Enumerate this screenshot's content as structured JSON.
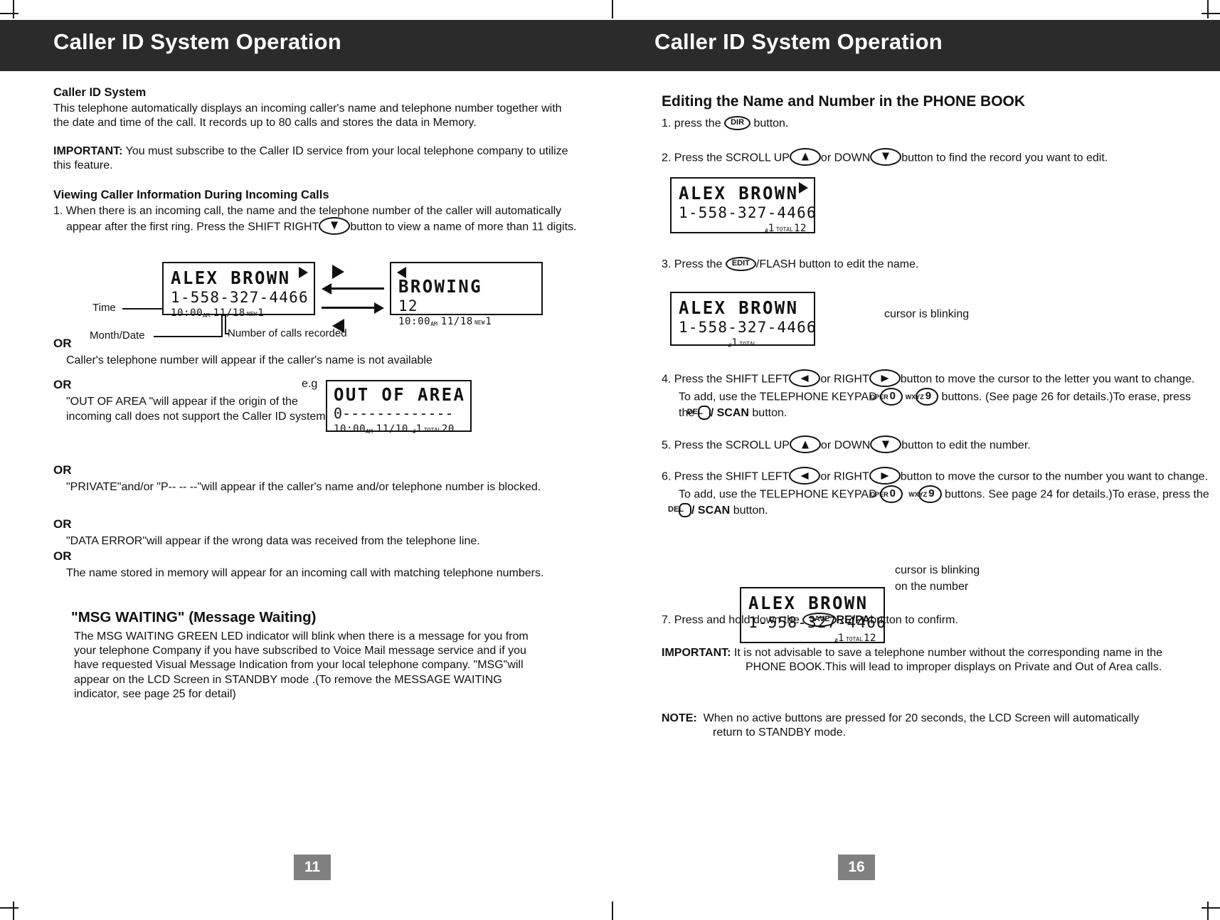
{
  "header": {
    "left_title": "Caller ID System Operation",
    "right_title": "Caller ID System Operation"
  },
  "page_numbers": {
    "left": "11",
    "right": "16"
  },
  "left_page": {
    "section1_heading": "Caller ID System",
    "section1_body": "This telephone automatically displays an incoming caller's name and telephone number together with the date and time of the call. It records up to 80 calls and stores the data in Memory.",
    "important_label": "IMPORTANT:",
    "important_body": " You must subscribe to the Caller ID service from your local telephone company to utilize this feature.",
    "section2_heading": "Viewing Caller Information During Incoming Calls",
    "step1_part1": "1. When there is an incoming call, the name and the telephone number of the caller will automatically appear after the first ring. Press the SHIFT RIGHT",
    "step1_part2": "button to view a name of more than 11 digits.",
    "callouts": {
      "time": "Time",
      "month_date": "Month/Date",
      "num_calls": "Number of calls recorded"
    },
    "lcd_primary": {
      "name": "ALEX BROWN",
      "number": "1-558-327-4466",
      "time": "10:00",
      "ampm": "AM",
      "date": "11/18",
      "new_label": "NEW",
      "count": "1",
      "arrow": "right-triangle"
    },
    "lcd_secondary": {
      "name": "BROWING",
      "number": "12",
      "time": "10:00",
      "ampm": "AM",
      "date": "11/18",
      "new_label": "NEW",
      "count": "1",
      "arrow": "left-triangle"
    },
    "or_label": "OR",
    "or1_body": "Caller's telephone number will appear if the caller's name is not available",
    "eg_label": "e.g",
    "or2_body": "\"OUT OF AREA \"will appear if the origin of the incoming call does not support the Caller ID system.",
    "lcd_out_of_area": {
      "line1": "OUT OF AREA",
      "line2": "0-------------",
      "time": "10:00",
      "ampm": "AM",
      "date": "11/10",
      "hash": "1",
      "total_label": "TOTAL",
      "total": "20"
    },
    "or3_body": "\"PRIVATE\"and/or \"P-- -- --\"will appear if the caller's name and/or telephone number is blocked.",
    "or4_body": "\"DATA ERROR\"will appear if the wrong data was received from the telephone line.",
    "or5_body": "The name stored in memory will appear for an incoming call with matching telephone numbers.",
    "msg_heading": "\"MSG WAITING\" (Message Waiting)",
    "msg_body": "The MSG WAITING GREEN LED indicator will blink when there is a message for you from your telephone Company if you have subscribed to Voice Mail message service and if you have requested Visual Message Indication from your local telephone company. \"MSG\"will appear on the LCD Screen in STANDBY mode .(To remove the MESSAGE WAITING indicator, see page 25 for detail)"
  },
  "right_page": {
    "heading": "Editing the Name and Number in the PHONE BOOK",
    "step1_pre": "1. press the",
    "step1_key": "DIR",
    "step1_post": "button.",
    "step2_pre": "2. Press the SCROLL UP",
    "step2_mid": "or DOWN",
    "step2_post": "button to find the record you want to edit.",
    "lcd_step2": {
      "name": "ALEX BROWN",
      "number": "1-558-327-4466",
      "hash": "1",
      "total_label": "TOTAL",
      "total": "12",
      "arrow": "right-triangle"
    },
    "step3_pre": "3. Press the",
    "step3_key": "EDIT",
    "step3_post": "/FLASH  button to edit the name.",
    "lcd_step3": {
      "name": "ALEX BROWN",
      "number": "1-558-327-4466",
      "hash": "1",
      "total_label": "TOTAL"
    },
    "note_cursor_name": "cursor is blinking",
    "step4_a": "4.  Press the SHIFT LEFT",
    "step4_b": "or RIGHT",
    "step4_c": "button to move the cursor to the letter you want to change. To add, use the TELEPHONE KEYPAD",
    "step4_d": "buttons.",
    "step4_e": "(See page 26 for details.)To erase,  press the",
    "step4_key_del": "DEL",
    "step4_f": "/ SCAN",
    "step4_g": "button.",
    "step5_a": "5.  Press the SCROLL  UP",
    "step5_b": "or DOWN",
    "step5_c": "button to edit the number.",
    "step6_a": "6.  Press  the SHIFT LEFT",
    "step6_b": "or RIGHT",
    "step6_c": "button to move the cursor to the number you want to change. To add, use the TELEPHONE KEYPAD",
    "step6_d": "buttons. See page 24 for details.)To erase, press the",
    "step6_e": "/ SCAN",
    "step6_f": "button.",
    "keypad_oper": "OPER",
    "keypad_oper_digit": "0",
    "keypad_wxyz": "WXYZ",
    "keypad_wxyz_digit": "9",
    "lcd_step6": {
      "name": "ALEX BROWN",
      "number": "1-558-327-4466",
      "hash": "1",
      "total_label": "TOTAL",
      "total": "12"
    },
    "note_cursor_number_l1": "cursor is blinking",
    "note_cursor_number_l2": "on the number",
    "step7_a": "7. Press and hold down the",
    "step7_key": "SAVE",
    "step7_b": "RE/PA",
    "step7_c": "button to confirm.",
    "important_label": "IMPORTANT:",
    "important_body": "It is not advisable to save a telephone number without the corresponding name in the PHONE BOOK.This will lead to improper displays on Private and Out of Area calls.",
    "note_label": "NOTE:",
    "note_body": "When no active buttons are pressed for 20 seconds, the LCD Screen will automatically return to STANDBY mode."
  },
  "colors": {
    "header_bg": "#2b2b2b",
    "header_text": "#ffffff",
    "page_badge_bg": "#808080",
    "text": "#111111"
  }
}
